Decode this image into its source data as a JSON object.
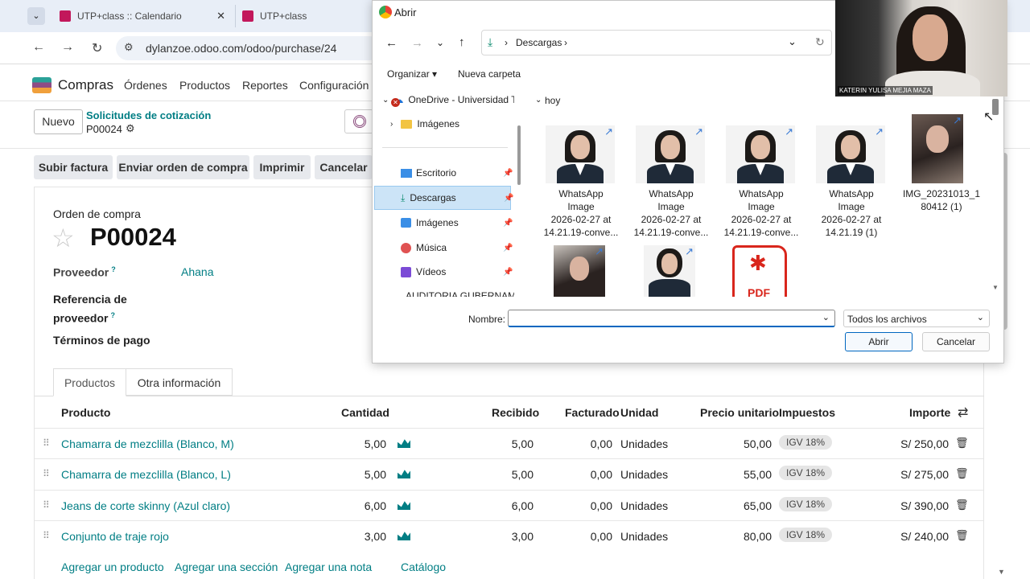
{
  "browser": {
    "tabs": [
      {
        "title": "UTP+class :: Calendario"
      },
      {
        "title": "UTP+class"
      }
    ],
    "close_glyph": "✕",
    "url": "dylanzoe.odoo.com/odoo/purchase/24"
  },
  "odoo": {
    "app_name": "Compras",
    "menu": [
      "Órdenes",
      "Productos",
      "Reportes",
      "Configuración"
    ],
    "new_button": "Nuevo",
    "breadcrumb_parent": "Solicitudes de cotización",
    "breadcrumb_current": "P00024",
    "actions": [
      "Subir factura",
      "Enviar orden de compra",
      "Imprimir",
      "Cancelar"
    ],
    "form": {
      "doc_type": "Orden de compra",
      "doc_number": "P00024",
      "supplier_label": "Proveedor",
      "help_mark": "?",
      "supplier_value": "Ahana",
      "supplier_ref_label_1": "Referencia de",
      "supplier_ref_label_2": "proveedor",
      "payment_terms_label": "Términos de pago"
    },
    "tabs": [
      "Productos",
      "Otra información"
    ],
    "table": {
      "headers": [
        "Producto",
        "Cantidad",
        "Recibido",
        "Facturado",
        "Unidad",
        "Precio unitario",
        "Impuestos",
        "Importe"
      ],
      "rows": [
        {
          "product": "Chamarra de mezclilla (Blanco, M)",
          "qty": "5,00",
          "received": "5,00",
          "billed": "0,00",
          "unit": "Unidades",
          "price": "50,00",
          "tax": "IGV 18%",
          "amount": "S/ 250,00"
        },
        {
          "product": "Chamarra de mezclilla (Blanco, L)",
          "qty": "5,00",
          "received": "5,00",
          "billed": "0,00",
          "unit": "Unidades",
          "price": "55,00",
          "tax": "IGV 18%",
          "amount": "S/ 275,00"
        },
        {
          "product": "Jeans de corte skinny (Azul claro)",
          "qty": "6,00",
          "received": "6,00",
          "billed": "0,00",
          "unit": "Unidades",
          "price": "65,00",
          "tax": "IGV 18%",
          "amount": "S/ 390,00"
        },
        {
          "product": "Conjunto de traje rojo",
          "qty": "3,00",
          "received": "3,00",
          "billed": "0,00",
          "unit": "Unidades",
          "price": "80,00",
          "tax": "IGV 18%",
          "amount": "S/ 240,00"
        }
      ]
    },
    "footer_links": [
      "Agregar un producto",
      "Agregar una sección",
      "Agregar una nota",
      "Catálogo"
    ]
  },
  "dialog": {
    "title": "Abrir",
    "path": [
      "Descargas"
    ],
    "toolbar": {
      "organize": "Organizar",
      "new_folder": "Nueva carpeta"
    },
    "nav": [
      {
        "label": "OneDrive - Universidad T",
        "icon": "cloud-icon"
      },
      {
        "label": "Imágenes",
        "icon": "folder-icon"
      },
      {
        "label": "Escritorio",
        "icon": "desktop-icon"
      },
      {
        "label": "Descargas",
        "icon": "download-icon"
      },
      {
        "label": "Imágenes",
        "icon": "images-icon"
      },
      {
        "label": "Música",
        "icon": "music-icon"
      },
      {
        "label": "Vídeos",
        "icon": "video-icon"
      },
      {
        "label": "AUDITORIA GUBERNAM",
        "icon": "folder-icon"
      }
    ],
    "group": "hoy",
    "files": [
      {
        "lines": [
          "WhatsApp",
          "Image",
          "2026-02-27 at",
          "14.21.19-conve..."
        ]
      },
      {
        "lines": [
          "WhatsApp",
          "Image",
          "2026-02-27 at",
          "14.21.19-conve..."
        ]
      },
      {
        "lines": [
          "WhatsApp",
          "Image",
          "2026-02-27 at",
          "14.21.19-conve..."
        ]
      },
      {
        "lines": [
          "WhatsApp",
          "Image",
          "2026-02-27 at",
          "14.21.19 (1)"
        ]
      },
      {
        "lines": [
          "IMG_20231013_1",
          "80412 (1)"
        ]
      }
    ],
    "pdf_label": "PDF",
    "name_label": "Nombre:",
    "name_value": "",
    "filter": "Todos los archivos",
    "open_button": "Abrir",
    "cancel_button": "Cancelar"
  },
  "webcam": {
    "caption": "KATERIN YULISA MEJIA MAZA"
  },
  "colors": {
    "odoo_teal": "#017e84",
    "selection": "#cce4f7",
    "accent_blue": "#0067c0"
  }
}
